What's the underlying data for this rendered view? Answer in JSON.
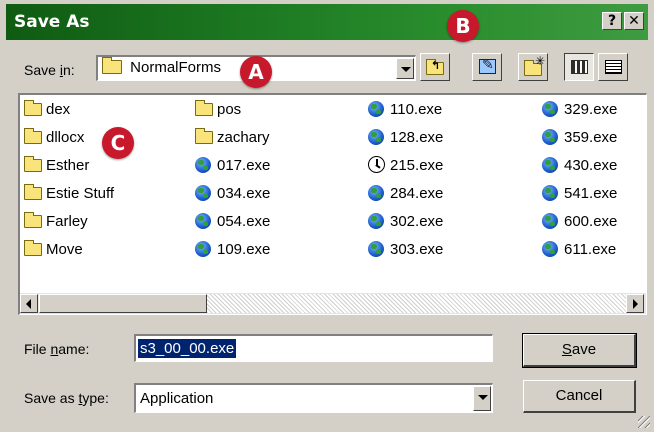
{
  "window": {
    "title": "Save As",
    "help_button": "?",
    "close_button": "✕"
  },
  "save_in": {
    "label_prefix": "Save ",
    "label_hotkey": "i",
    "label_suffix": "n:",
    "folder_name": "NormalForms"
  },
  "annotations": {
    "a": "A",
    "b": "B",
    "c": "C"
  },
  "file_list": {
    "columns": [
      [
        {
          "name": "dex",
          "icon": "folder-icon"
        },
        {
          "name": "dllocx",
          "icon": "folder-icon"
        },
        {
          "name": "Esther",
          "icon": "folder-icon"
        },
        {
          "name": "Estie Stuff",
          "icon": "folder-icon"
        },
        {
          "name": "Farley",
          "icon": "folder-icon"
        },
        {
          "name": "Move",
          "icon": "folder-icon"
        }
      ],
      [
        {
          "name": "pos",
          "icon": "folder-icon"
        },
        {
          "name": "zachary",
          "icon": "folder-icon"
        },
        {
          "name": "017.exe",
          "icon": "globe-icon"
        },
        {
          "name": "034.exe",
          "icon": "globe-icon"
        },
        {
          "name": "054.exe",
          "icon": "globe-icon"
        },
        {
          "name": "109.exe",
          "icon": "globe-icon"
        }
      ],
      [
        {
          "name": "110.exe",
          "icon": "globe-icon"
        },
        {
          "name": "128.exe",
          "icon": "globe-icon"
        },
        {
          "name": "215.exe",
          "icon": "clock-icon"
        },
        {
          "name": "284.exe",
          "icon": "globe-icon"
        },
        {
          "name": "302.exe",
          "icon": "globe-icon"
        },
        {
          "name": "303.exe",
          "icon": "globe-icon"
        }
      ],
      [
        {
          "name": "329.exe",
          "icon": "globe-icon"
        },
        {
          "name": "359.exe",
          "icon": "globe-icon"
        },
        {
          "name": "430.exe",
          "icon": "globe-icon"
        },
        {
          "name": "541.exe",
          "icon": "globe-icon"
        },
        {
          "name": "600.exe",
          "icon": "globe-icon"
        },
        {
          "name": "611.exe",
          "icon": "globe-icon"
        }
      ]
    ]
  },
  "file_name": {
    "label_prefix": "File ",
    "label_hotkey": "n",
    "label_suffix": "ame:",
    "value": "s3_00_00.exe"
  },
  "save_as_type": {
    "label_prefix": "Save as ",
    "label_hotkey": "t",
    "label_suffix": "ype:",
    "value": "Application"
  },
  "buttons": {
    "save_hotkey": "S",
    "save_rest": "ave",
    "cancel": "Cancel"
  },
  "colors": {
    "title_gradient_start": "#0f5b12",
    "title_gradient_end": "#3f9b41",
    "annotation_badge": "#c8182b",
    "selection": "#00236f"
  }
}
